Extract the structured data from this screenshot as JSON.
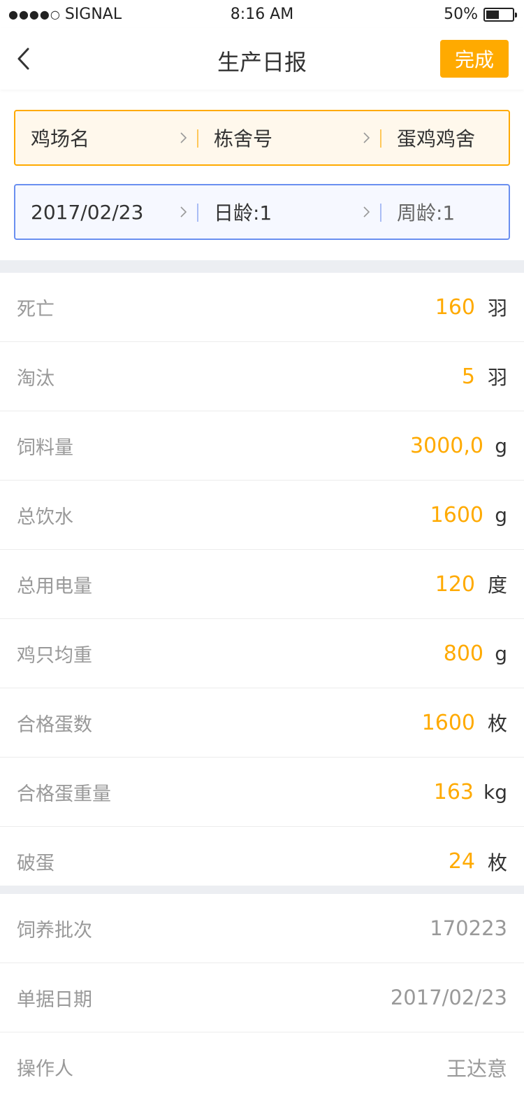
{
  "status": {
    "signal_dots": "●●●●○",
    "carrier": "SIGNAL",
    "time": "8:16 AM",
    "battery": "50%",
    "battery_level": 0.5
  },
  "nav": {
    "title": "生产日报",
    "done_label": "完成"
  },
  "farm_selector": {
    "farm": "鸡场名",
    "house": "栋舍号",
    "type": "蛋鸡鸡舍"
  },
  "date_selector": {
    "date": "2017/02/23",
    "day_age": "日龄:1",
    "week_age": "周龄:1"
  },
  "metrics": [
    {
      "label": "死亡",
      "value": "160",
      "unit": "羽"
    },
    {
      "label": "淘汰",
      "value": "5",
      "unit": "羽"
    },
    {
      "label": "饲料量",
      "value": "3000,0",
      "unit": "g"
    },
    {
      "label": "总饮水",
      "value": "1600",
      "unit": "g"
    },
    {
      "label": "总用电量",
      "value": "120",
      "unit": "度"
    },
    {
      "label": "鸡只均重",
      "value": "800",
      "unit": "g"
    },
    {
      "label": "合格蛋数",
      "value": "1600",
      "unit": "枚"
    },
    {
      "label": "合格蛋重量",
      "value": "163",
      "unit": "kg"
    },
    {
      "label": "破蛋",
      "value": "24",
      "unit": "枚"
    }
  ],
  "info": [
    {
      "label": "饲养批次",
      "value": "170223"
    },
    {
      "label": "单据日期",
      "value": "2017/02/23"
    },
    {
      "label": "操作人",
      "value": "王达意"
    }
  ],
  "colors": {
    "accent": "#ffaa00",
    "blue_border": "#6a8ff0"
  }
}
